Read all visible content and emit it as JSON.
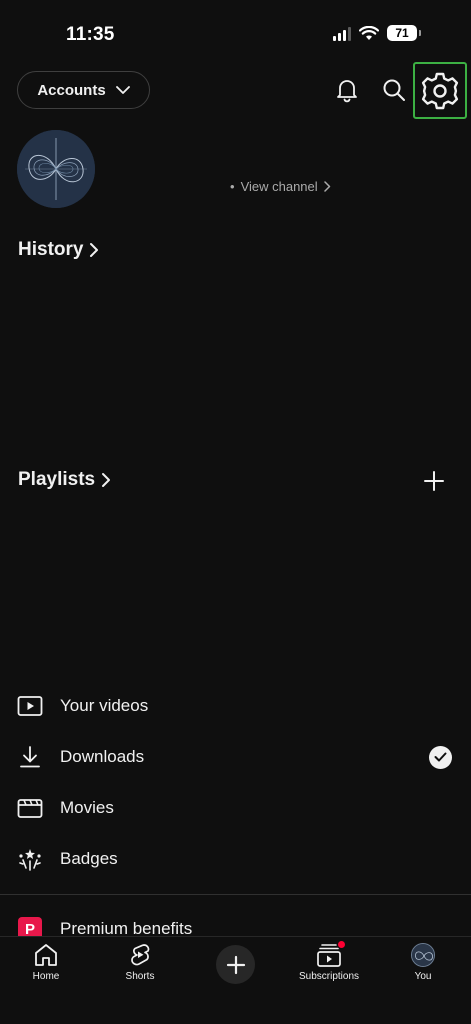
{
  "status_bar": {
    "time": "11:35",
    "battery": "71"
  },
  "header": {
    "accounts_label": "Accounts"
  },
  "profile": {
    "view_channel": "View channel"
  },
  "sections": {
    "history": "History",
    "playlists": "Playlists"
  },
  "menu": [
    {
      "label": "Your videos",
      "icon": "play-square-icon"
    },
    {
      "label": "Downloads",
      "icon": "download-icon"
    },
    {
      "label": "Movies",
      "icon": "clapperboard-icon"
    },
    {
      "label": "Badges",
      "icon": "badges-icon"
    },
    {
      "label": "Premium benefits",
      "icon": "premium-icon",
      "icon_text": "P"
    }
  ],
  "bottom_nav": [
    {
      "label": "Home",
      "icon": "home-icon"
    },
    {
      "label": "Shorts",
      "icon": "shorts-icon"
    },
    {
      "label": "",
      "icon": "create-icon"
    },
    {
      "label": "Subscriptions",
      "icon": "subscriptions-icon"
    },
    {
      "label": "You",
      "icon": "avatar-icon"
    }
  ],
  "colors": {
    "background": "#0f0f0f",
    "accent_red": "#ff0033",
    "premium_red": "#e8184b",
    "highlight_green": "#3cb043"
  }
}
